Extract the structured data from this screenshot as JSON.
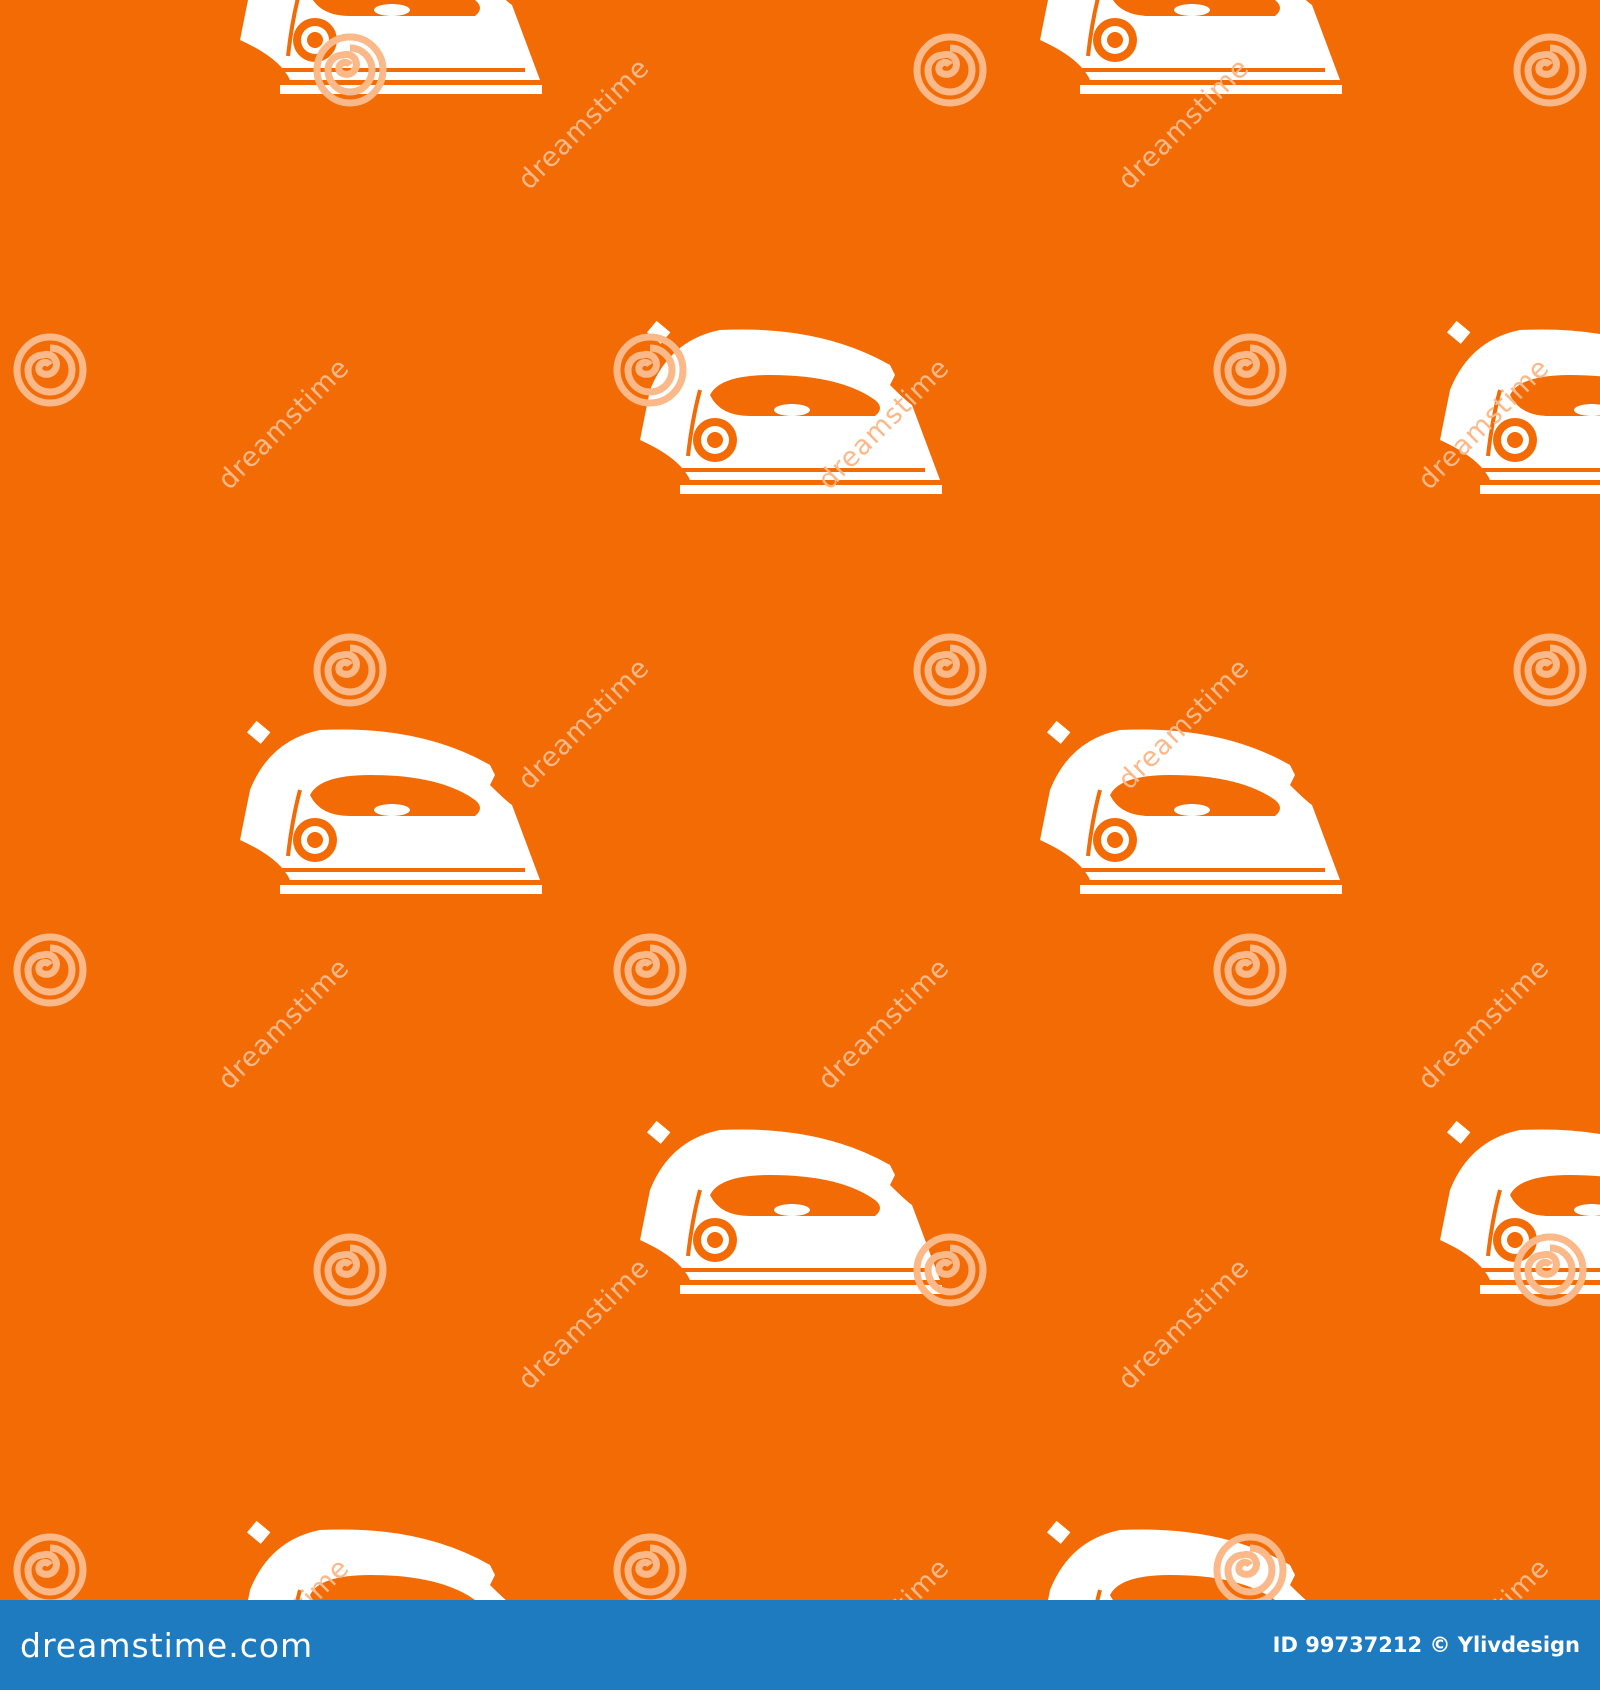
{
  "colors": {
    "background": "#f26b04",
    "icon": "#ffffff",
    "watermark": "#fbb98a",
    "footer_bg": "#1f7bbf",
    "footer_text": "#ffffff"
  },
  "pattern": {
    "icon_name": "steam-iron-icon",
    "watermark_icon_name": "dreamstime-spiral-icon"
  },
  "watermark": {
    "text": "dreamstime"
  },
  "footer": {
    "logo_text": "dreamstime.com",
    "image_id": "ID 99737212",
    "credit": "© Ylivdesign"
  }
}
